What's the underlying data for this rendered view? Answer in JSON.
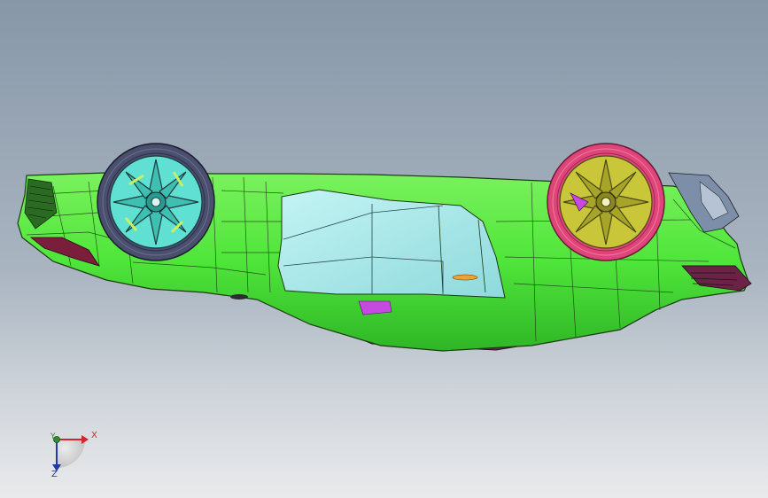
{
  "viewport": {
    "background_top": "#8797a8",
    "background_bottom": "#e9eaec"
  },
  "model": {
    "body_color": "#4fe53a",
    "glass_color": "#a8eded",
    "underbody_color": "#6e2a4a",
    "front_wheel_rim_color": "#5fe0d2",
    "rear_wheel_rim_color": "#c9c63a",
    "front_tire_color": "#4a4f6e",
    "rear_tire_color": "#e0457a",
    "edge_color": "#1a3a12"
  },
  "triad": {
    "x_label": "X",
    "y_label": "Y",
    "z_label": "Z",
    "x_color": "#d4252a",
    "y_color": "#2c8f2c",
    "z_color": "#2438a8"
  }
}
